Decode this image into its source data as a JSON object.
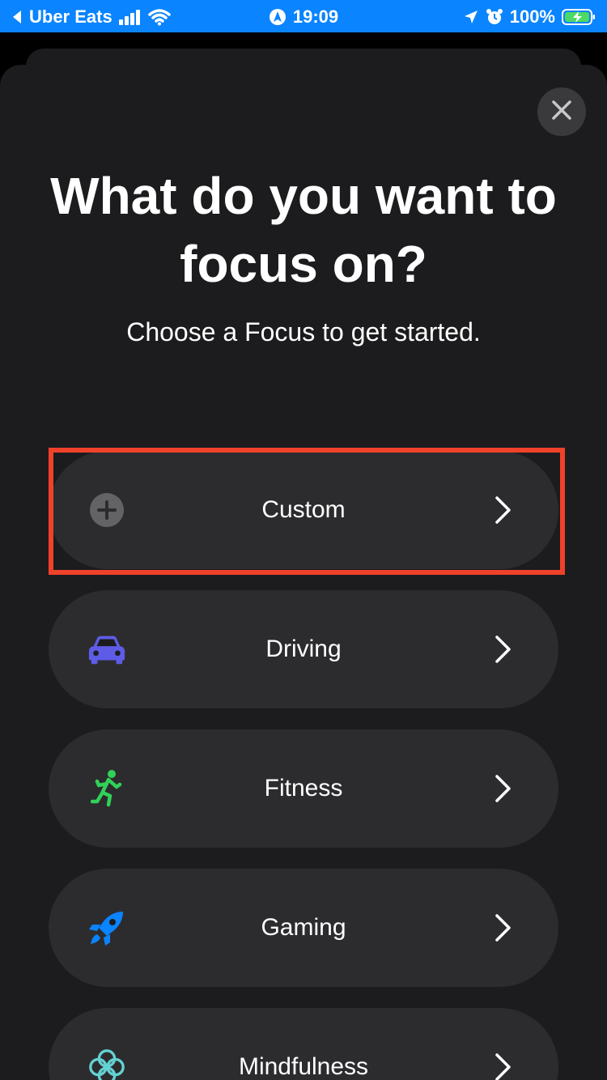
{
  "status_bar": {
    "back_app": "Uber Eats",
    "time": "19:09",
    "battery": "100%"
  },
  "title_line1": "What do you want to",
  "title_line2": "focus on?",
  "subtitle": "Choose a Focus to get started.",
  "options": [
    {
      "label": "Custom",
      "icon": "plus-circle-icon"
    },
    {
      "label": "Driving",
      "icon": "car-icon"
    },
    {
      "label": "Fitness",
      "icon": "runner-icon"
    },
    {
      "label": "Gaming",
      "icon": "rocket-icon"
    },
    {
      "label": "Mindfulness",
      "icon": "flower-icon"
    }
  ],
  "colors": {
    "status_bar": "#0a84ff",
    "sheet": "#1c1c1e",
    "option": "#2c2c2e",
    "highlight": "#f0412b",
    "driving_icon": "#5e5ce6",
    "fitness_icon": "#30d158",
    "gaming_icon": "#0a84ff",
    "mindfulness_icon": "#64d2d2"
  }
}
